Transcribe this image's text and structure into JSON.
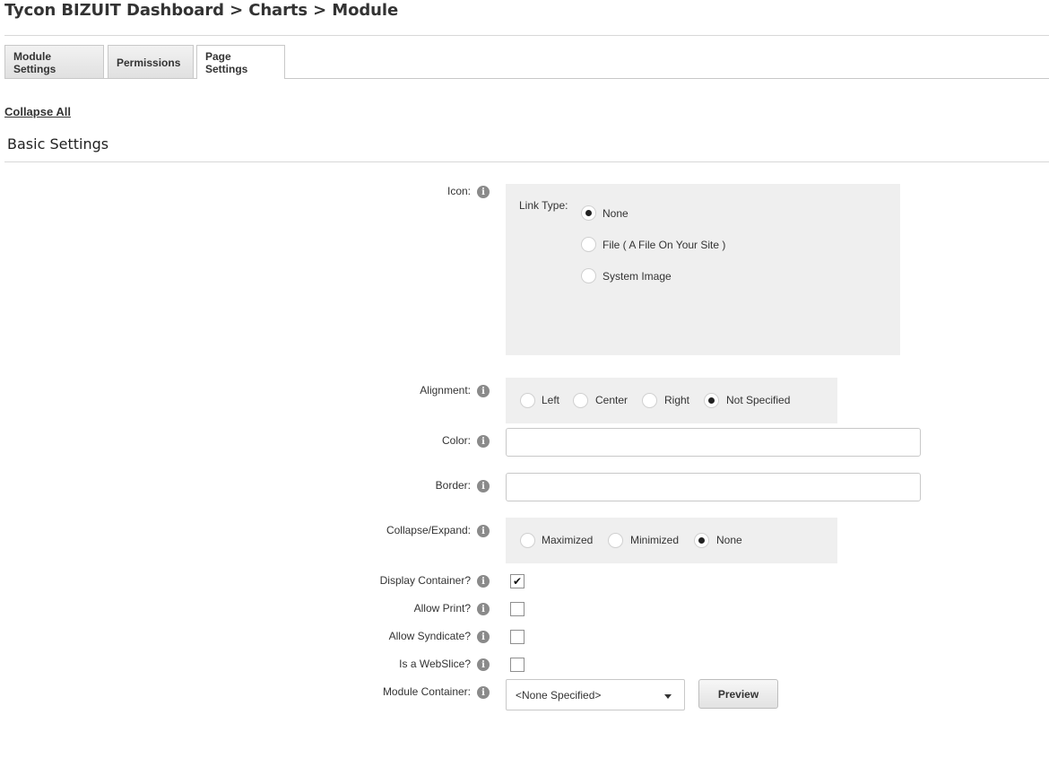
{
  "header": {
    "title": "Tycon BIZUIT Dashboard > Charts > Module"
  },
  "tabs": [
    {
      "label": "Module Settings"
    },
    {
      "label": "Permissions"
    },
    {
      "label": "Page Settings",
      "active": true
    }
  ],
  "collapse_all": "Collapse All",
  "section": {
    "title": "Basic Settings"
  },
  "info_glyph": "i",
  "fields": {
    "icon": {
      "label": "Icon:",
      "link_type_label": "Link Type:",
      "options": [
        "None",
        "File ( A File On Your Site )",
        "System Image"
      ],
      "selected": "None"
    },
    "alignment": {
      "label": "Alignment:",
      "options": [
        "Left",
        "Center",
        "Right",
        "Not Specified"
      ],
      "selected": "Not Specified"
    },
    "color": {
      "label": "Color:",
      "value": ""
    },
    "border": {
      "label": "Border:",
      "value": ""
    },
    "collapse_expand": {
      "label": "Collapse/Expand:",
      "options": [
        "Maximized",
        "Minimized",
        "None"
      ],
      "selected": "None"
    },
    "display_container": {
      "label": "Display Container?",
      "checked": true
    },
    "allow_print": {
      "label": "Allow Print?",
      "checked": false
    },
    "allow_syndicate": {
      "label": "Allow Syndicate?",
      "checked": false
    },
    "is_webslice": {
      "label": "Is a WebSlice?",
      "checked": false
    },
    "module_container": {
      "label": "Module Container:",
      "value": "<None Specified>"
    }
  },
  "preview_button": "Preview",
  "checkmark_glyph": "✔",
  "icons": {
    "info": "info-icon",
    "dropdown": "chevron-down-icon",
    "check": "checkmark-icon"
  },
  "colors": {
    "panel_bg": "#efefef",
    "text": "#333333",
    "info_icon": "#8a8a8a"
  }
}
